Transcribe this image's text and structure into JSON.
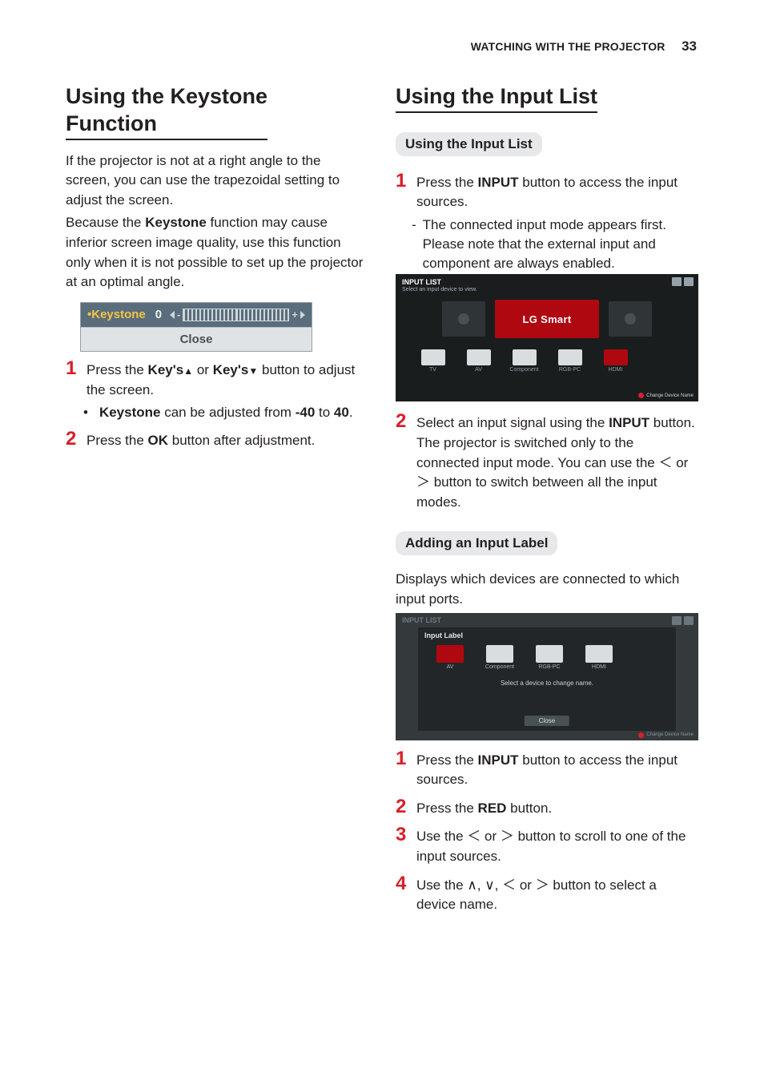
{
  "header": {
    "section": "WATCHING WITH THE PROJECTOR",
    "page": "33"
  },
  "left": {
    "title_line1": "Using the Keystone",
    "title_line2": "Function",
    "intro": "If the projector is not at a right angle to the screen, you can use the trapezoidal setting to adjust the screen.",
    "intro2a": "Because the ",
    "intro2_bold": "Keystone",
    "intro2b": " function may cause inferior screen image quality, use this function only when it is not possible to set up the projector at an optimal angle.",
    "keystone_fig": {
      "label": "•Keystone",
      "value": "0",
      "close": "Close"
    },
    "step1_a": "Press the ",
    "step1_b1": "Key's",
    "step1_mid": " or ",
    "step1_b2": "Key's",
    "step1_c": " button to adjust the screen.",
    "step1_note_a": "Keystone",
    "step1_note_b": " can be adjusted from ",
    "step1_note_c": "-40",
    "step1_note_d": " to ",
    "step1_note_e": "40",
    "step1_note_f": ".",
    "step2_a": "Press the ",
    "step2_b": "OK",
    "step2_c": " button after adjustment."
  },
  "right": {
    "title": "Using the Input List",
    "sub1": "Using the Input List",
    "s1_a": "Press the ",
    "s1_b": "INPUT",
    "s1_c": " button to access the input sources.",
    "s1_note": "The connected input mode appears first. Please note that the external input and component are always enabled.",
    "fig1": {
      "title": "INPUT LIST",
      "subtitle": "Select an input device to view.",
      "lg": "LG Smart",
      "sources": [
        "TV",
        "AV",
        "Component",
        "RGB-PC",
        "HDMI"
      ],
      "change": "Change Device Name"
    },
    "s2_a": "Select an input signal using the ",
    "s2_b": "INPUT",
    "s2_c": " button. The projector is switched only to the connected input mode. You can use the ",
    "s2_d": " or ",
    "s2_e": " button to switch between all the input modes.",
    "sub2": "Adding an Input Label",
    "sub2_desc": "Displays which devices are connected to which input ports.",
    "fig2": {
      "title": "INPUT LIST",
      "panel_title": "Input Label",
      "sources": [
        "AV",
        "Component",
        "RGB-PC",
        "HDMI"
      ],
      "select": "Select a device to change name.",
      "close": "Close",
      "change": "Change Device Name"
    },
    "b1_a": "Press the ",
    "b1_b": "INPUT",
    "b1_c": " button to access the input sources.",
    "b2_a": "Press the ",
    "b2_b": "RED",
    "b2_c": " button.",
    "b3_a": "Use the ",
    "b3_b": " or ",
    "b3_c": " button to scroll to one of the input sources.",
    "b4_a": "Use the ",
    "b4_b": ", ",
    "b4_c": ", ",
    "b4_d": " or ",
    "b4_e": " button to select a device name."
  },
  "glyphs": {
    "lt": "＜",
    "gt": "＞",
    "up": "∧",
    "down": "∨"
  }
}
